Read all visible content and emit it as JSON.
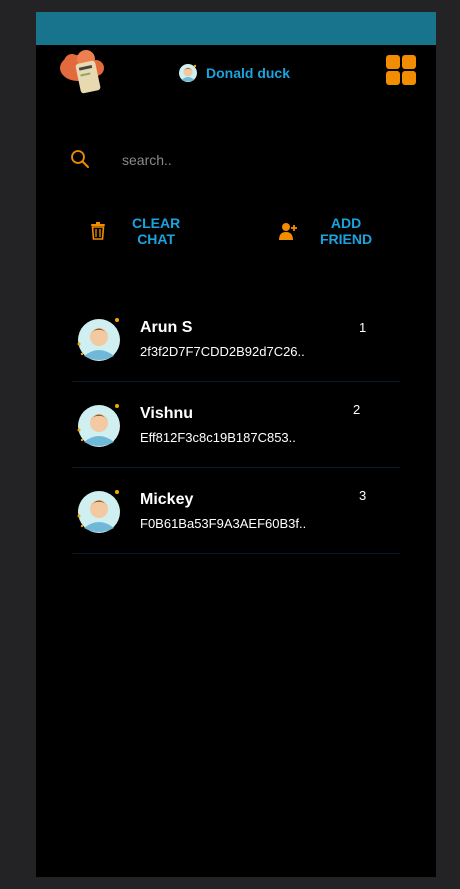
{
  "header": {
    "user_name": "Donald duck",
    "logo_icon": "cloud-chat-logo-icon",
    "menu_icon": "grid-menu-icon"
  },
  "search": {
    "placeholder": "search..",
    "icon": "search-icon"
  },
  "actions": {
    "clear_chat_label": "CLEAR\nCHAT",
    "add_friend_label": "ADD\nFRIEND"
  },
  "friends": [
    {
      "name": "Arun S",
      "address": "2f3f2D7F7CDD2B92d7C26..",
      "number": "1"
    },
    {
      "name": "Vishnu",
      "address": "Eff812F3c8c19B187C853..",
      "number": "2"
    },
    {
      "name": "Mickey",
      "address": "F0B61Ba53F9A3AEF60B3f..",
      "number": "3"
    }
  ],
  "colors": {
    "statusbar": "#18738c",
    "accent_blue": "#1aa3df",
    "accent_orange": "#f28c00",
    "background": "#000000"
  }
}
